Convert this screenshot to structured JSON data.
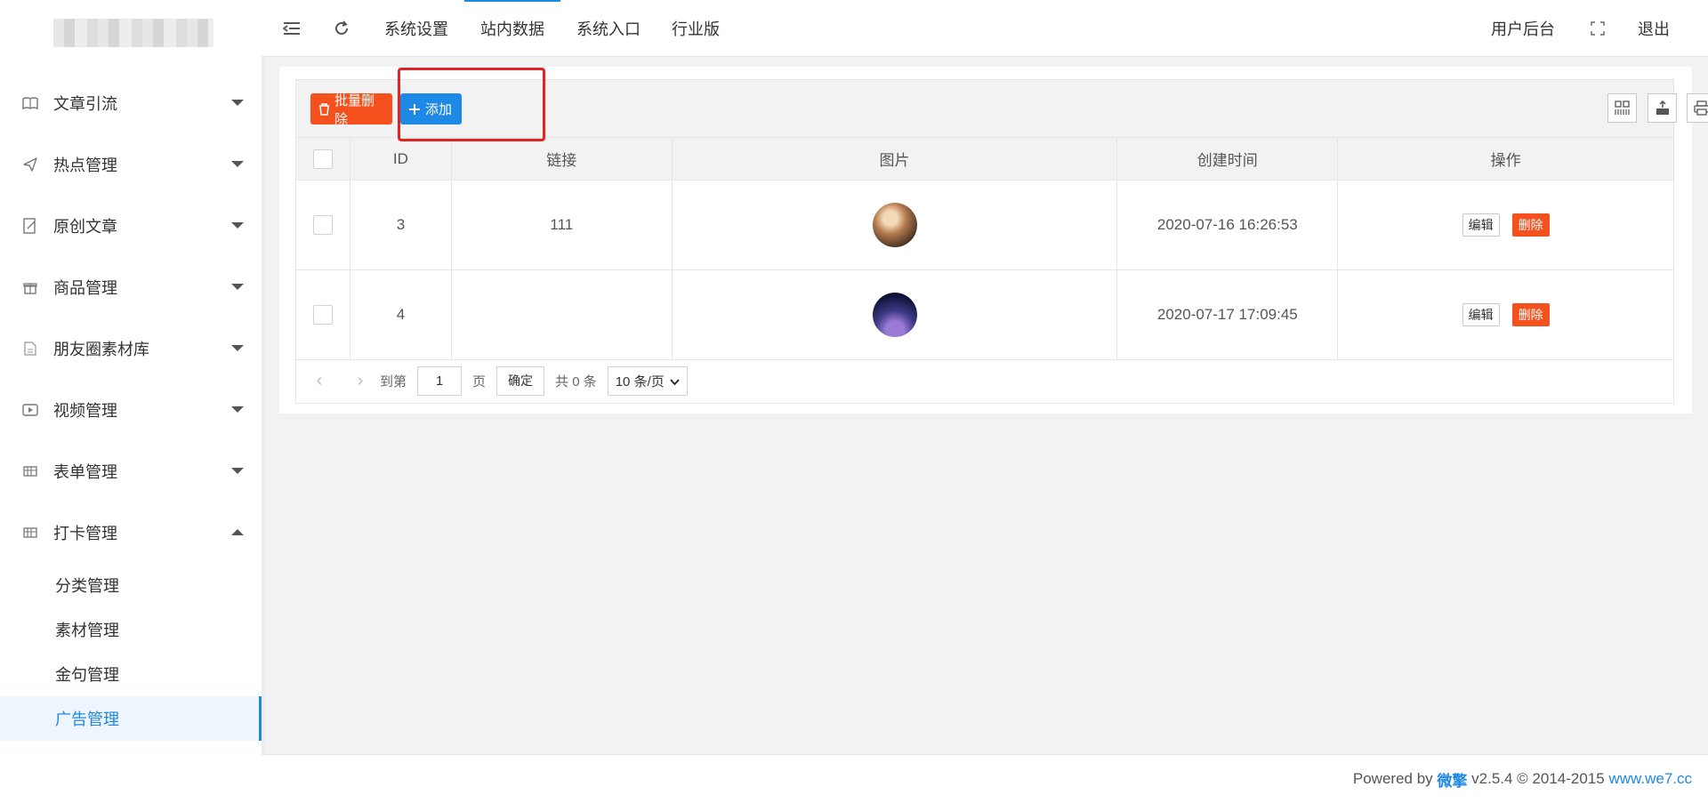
{
  "sidebar": {
    "menu": [
      {
        "label": "文章引流",
        "icon": "book-icon",
        "expanded": false
      },
      {
        "label": "热点管理",
        "icon": "send-icon",
        "expanded": false
      },
      {
        "label": "原创文章",
        "icon": "edit-document-icon",
        "expanded": false
      },
      {
        "label": "商品管理",
        "icon": "gift-icon",
        "expanded": false
      },
      {
        "label": "朋友圈素材库",
        "icon": "file-icon",
        "expanded": false
      },
      {
        "label": "视频管理",
        "icon": "video-icon",
        "expanded": false
      },
      {
        "label": "表单管理",
        "icon": "table-icon",
        "expanded": false
      },
      {
        "label": "打卡管理",
        "icon": "table-icon",
        "expanded": true
      }
    ],
    "submenu": [
      "分类管理",
      "素材管理",
      "金句管理",
      "广告管理"
    ],
    "active_sub": "广告管理"
  },
  "topbar": {
    "tabs": [
      "系统设置",
      "站内数据",
      "系统入口",
      "行业版"
    ],
    "active_tab": "站内数据",
    "user_backend": "用户后台",
    "logout": "退出"
  },
  "toolbar": {
    "batch_delete": "批量删除",
    "add": "添加"
  },
  "table": {
    "headers": [
      "ID",
      "链接",
      "图片",
      "创建时间",
      "操作"
    ],
    "rows": [
      {
        "id": "3",
        "link": "111",
        "created": "2020-07-16 16:26:53"
      },
      {
        "id": "4",
        "link": "",
        "created": "2020-07-17 17:09:45"
      }
    ],
    "edit_label": "编辑",
    "delete_label": "删除"
  },
  "pager": {
    "goto": "到第",
    "page_value": "1",
    "page_unit": "页",
    "confirm": "确定",
    "total": "共 0 条",
    "per_page": "10 条/页"
  },
  "footer": {
    "powered": "Powered by",
    "brand": "微擎",
    "version": "v2.5.4 © 2014-2015",
    "site": "www.we7.cc"
  },
  "colors": {
    "primary": "#1e88e5",
    "danger": "#f4511e",
    "highlight": "#e52222"
  }
}
